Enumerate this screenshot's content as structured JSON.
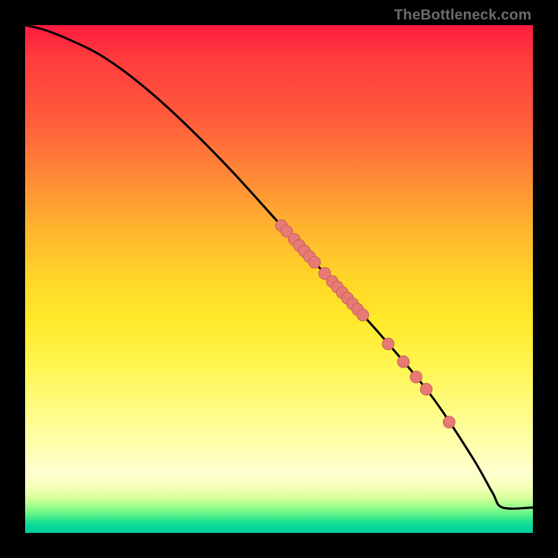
{
  "watermark": {
    "text": "TheBottleneck.com"
  },
  "chart_data": {
    "type": "line",
    "title": "",
    "xlabel": "",
    "ylabel": "",
    "xlim": [
      0,
      100
    ],
    "ylim": [
      0,
      100
    ],
    "grid": false,
    "legend": false,
    "series": [
      {
        "name": "curve",
        "x": [
          0,
          4,
          9,
          15,
          22,
          30,
          40,
          50,
          60,
          70,
          80,
          88,
          92,
          94,
          100
        ],
        "y": [
          100,
          99,
          97,
          94,
          89,
          82,
          72,
          61,
          50,
          39,
          27,
          15,
          8,
          5,
          5
        ]
      }
    ],
    "points": [
      {
        "x": 50.5,
        "y": 60.5
      },
      {
        "x": 51.5,
        "y": 59.4
      },
      {
        "x": 53.0,
        "y": 57.8
      },
      {
        "x": 54.0,
        "y": 56.6
      },
      {
        "x": 55.0,
        "y": 55.5
      },
      {
        "x": 56.0,
        "y": 54.4
      },
      {
        "x": 57.0,
        "y": 53.3
      },
      {
        "x": 59.0,
        "y": 51.1
      },
      {
        "x": 60.5,
        "y": 49.5
      },
      {
        "x": 61.5,
        "y": 48.4
      },
      {
        "x": 62.5,
        "y": 47.3
      },
      {
        "x": 63.5,
        "y": 46.2
      },
      {
        "x": 64.5,
        "y": 45.1
      },
      {
        "x": 65.5,
        "y": 44.0
      },
      {
        "x": 66.5,
        "y": 42.9
      },
      {
        "x": 71.5,
        "y": 37.2
      },
      {
        "x": 74.5,
        "y": 33.7
      },
      {
        "x": 77.0,
        "y": 30.7
      },
      {
        "x": 79.0,
        "y": 28.3
      },
      {
        "x": 83.5,
        "y": 21.8
      }
    ],
    "colors": {
      "curve_stroke": "#000000",
      "point_fill": "#e77a74",
      "point_stroke": "#c85f58"
    }
  }
}
